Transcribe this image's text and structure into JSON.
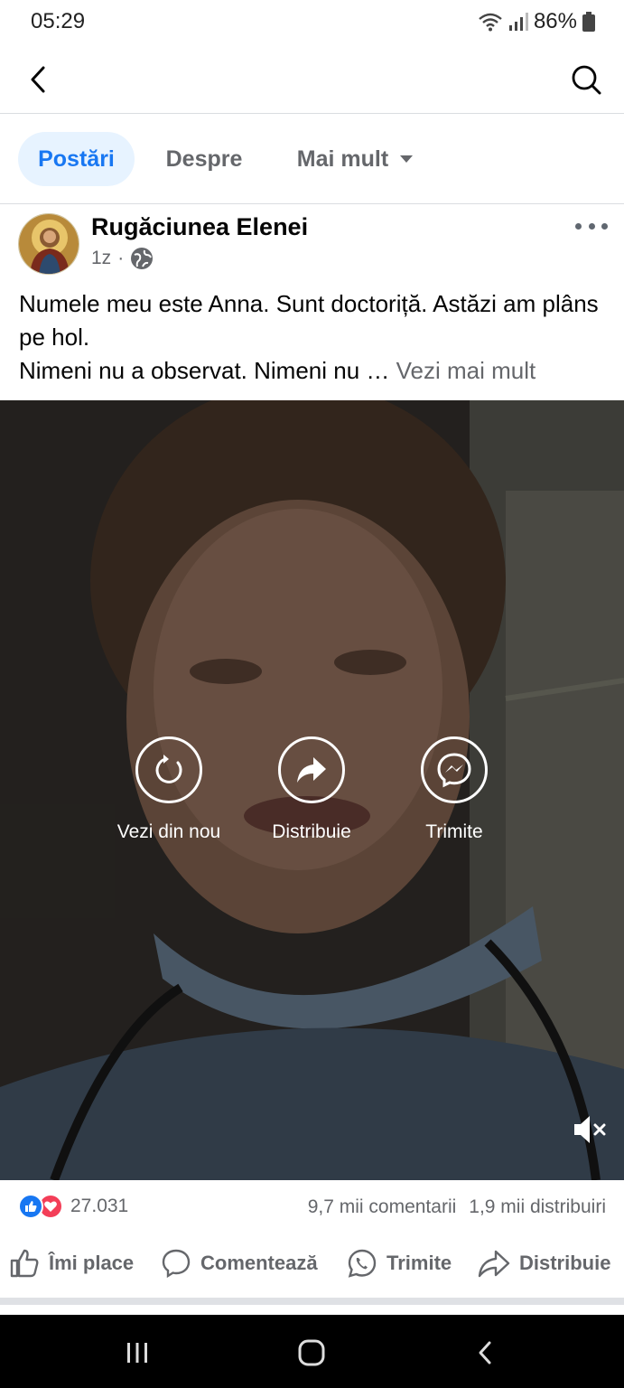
{
  "status_bar": {
    "time": "05:29",
    "battery": "86%"
  },
  "top_bar": {
    "back_icon": "chevron-left-icon",
    "search_icon": "search-icon"
  },
  "tabs": [
    {
      "label": "Postări",
      "active": true
    },
    {
      "label": "Despre",
      "active": false
    },
    {
      "label": "Mai mult",
      "active": false
    }
  ],
  "post": {
    "page_name": "Rugăciunea Elenei",
    "time": "1z",
    "separator": "·",
    "audience_icon": "globe-icon",
    "text_line1": "Numele meu este Anna. Sunt doctoriță. Astăzi am plâns pe hol.",
    "text_line2": "Nimeni nu a observat. Nimeni nu …",
    "see_more": "Vezi mai mult"
  },
  "video": {
    "actions": [
      {
        "label": "Vezi din nou",
        "icon": "replay-icon"
      },
      {
        "label": "Distribuie",
        "icon": "share-arrow-icon"
      },
      {
        "label": "Trimite",
        "icon": "messenger-icon"
      }
    ],
    "mute_icon": "muted-speaker-icon"
  },
  "stats": {
    "reaction_count": "27.031",
    "comments": "9,7 mii comentarii",
    "shares": "1,9 mii distribuiri"
  },
  "action_bar": {
    "like": "Îmi place",
    "comment": "Comentează",
    "send": "Trimite",
    "share": "Distribuie"
  },
  "colors": {
    "accent": "#1877f2",
    "tab_active_bg": "#e7f3ff",
    "muted_text": "#65676b",
    "love": "#f33e58"
  }
}
